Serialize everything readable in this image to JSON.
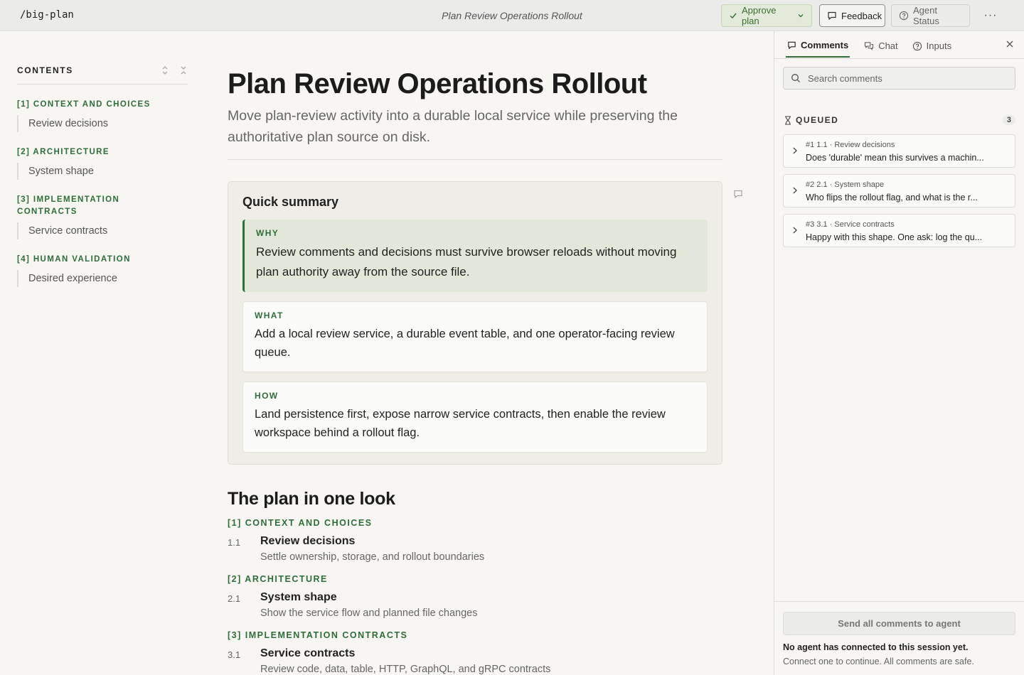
{
  "topbar": {
    "command": "/big-plan",
    "title": "Plan Review Operations Rollout",
    "approve_label": "Approve plan",
    "feedback_label": "Feedback",
    "status_label": "Agent Status",
    "more_label": "···"
  },
  "toc": {
    "heading": "CONTENTS",
    "sections": [
      {
        "label": "[1] CONTEXT AND CHOICES",
        "item": "Review decisions"
      },
      {
        "label": "[2] ARCHITECTURE",
        "item": "System shape"
      },
      {
        "label": "[3] IMPLEMENTATION CONTRACTS",
        "item": "Service contracts"
      },
      {
        "label": "[4] HUMAN VALIDATION",
        "item": "Desired experience"
      }
    ]
  },
  "main": {
    "title": "Plan Review Operations Rollout",
    "subtitle": "Move plan-review activity into a durable local service while preserving the authoritative plan source on disk.",
    "summary": {
      "heading": "Quick summary",
      "why_label": "WHY",
      "why_text": "Review comments and decisions must survive browser reloads without moving plan authority away from the source file.",
      "what_label": "WHAT",
      "what_text": "Add a local review service, a durable event table, and one operator-facing review queue.",
      "how_label": "HOW",
      "how_text": "Land persistence first, expose narrow service contracts, then enable the review workspace behind a rollout flag."
    },
    "plan": {
      "heading": "The plan in one look",
      "sections": [
        {
          "label": "[1] CONTEXT AND CHOICES",
          "num": "1.1",
          "title": "Review decisions",
          "desc": "Settle ownership, storage, and rollout boundaries"
        },
        {
          "label": "[2] ARCHITECTURE",
          "num": "2.1",
          "title": "System shape",
          "desc": "Show the service flow and planned file changes"
        },
        {
          "label": "[3] IMPLEMENTATION CONTRACTS",
          "num": "3.1",
          "title": "Service contracts",
          "desc": "Review code, data, table, HTTP, GraphQL, and gRPC contracts"
        }
      ]
    }
  },
  "panel": {
    "tabs": {
      "comments": "Comments",
      "chat": "Chat",
      "inputs": "Inputs"
    },
    "search_placeholder": "Search comments",
    "queue_label": "QUEUED",
    "queue_count": "3",
    "items": [
      {
        "meta": "#1  1.1 · Review decisions",
        "text": "Does 'durable' mean this survives a machin..."
      },
      {
        "meta": "#2  2.1 · System shape",
        "text": "Who flips the rollout flag, and what is the r..."
      },
      {
        "meta": "#3  3.1 · Service contracts",
        "text": "Happy with this shape. One ask: log the qu..."
      }
    ],
    "send_label": "Send all comments to agent",
    "footer_strong": "No agent has connected to this session yet.",
    "footer_sub": "Connect one to continue. All comments are safe."
  }
}
